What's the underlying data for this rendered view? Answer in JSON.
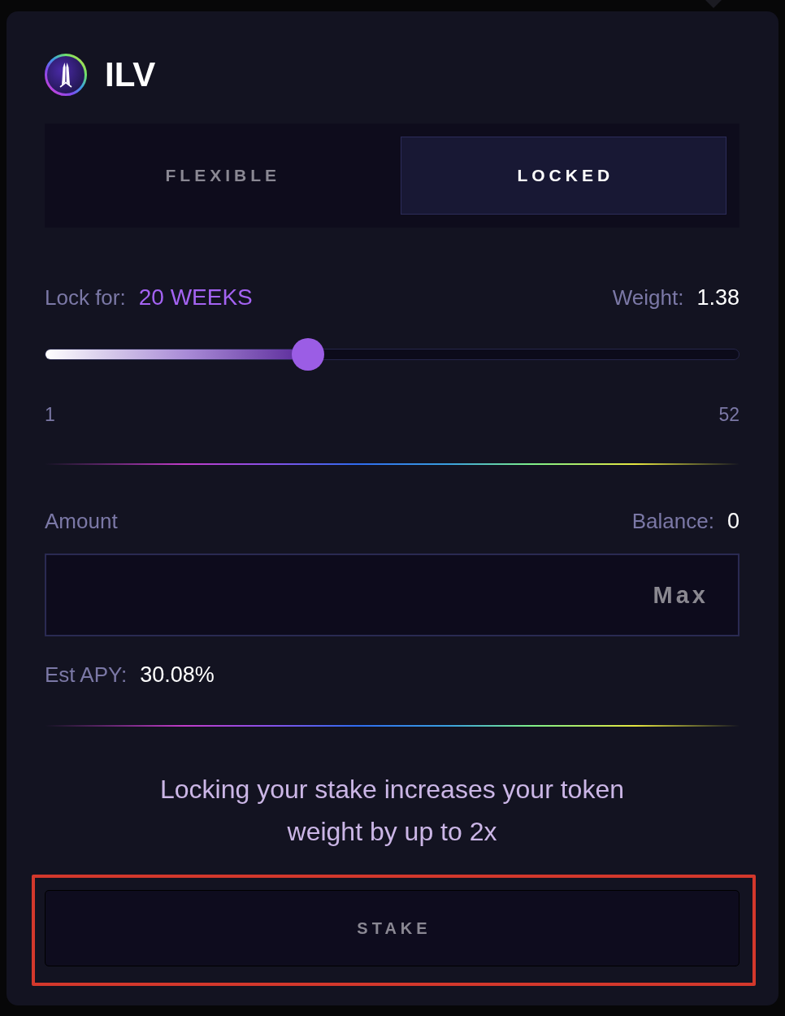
{
  "token": {
    "name": "ILV"
  },
  "tabs": [
    {
      "label": "FLEXIBLE",
      "selected": false
    },
    {
      "label": "LOCKED",
      "selected": true
    }
  ],
  "lock": {
    "label": "Lock for:",
    "value": "20 WEEKS",
    "weight_label": "Weight:",
    "weight_value": "1.38"
  },
  "slider": {
    "level": 0.373,
    "min_label": "1",
    "max_label": "52"
  },
  "amount": {
    "label": "Amount",
    "balance_label": "Balance:",
    "balance_value": "0",
    "max_button": "Max"
  },
  "apy": {
    "label": "Est APY:",
    "value": "30.08%"
  },
  "info": "Locking your stake increases your token weight by up to 2x",
  "stake_button": {
    "label": "STAKE",
    "disabled": true,
    "highlighted": true
  }
}
